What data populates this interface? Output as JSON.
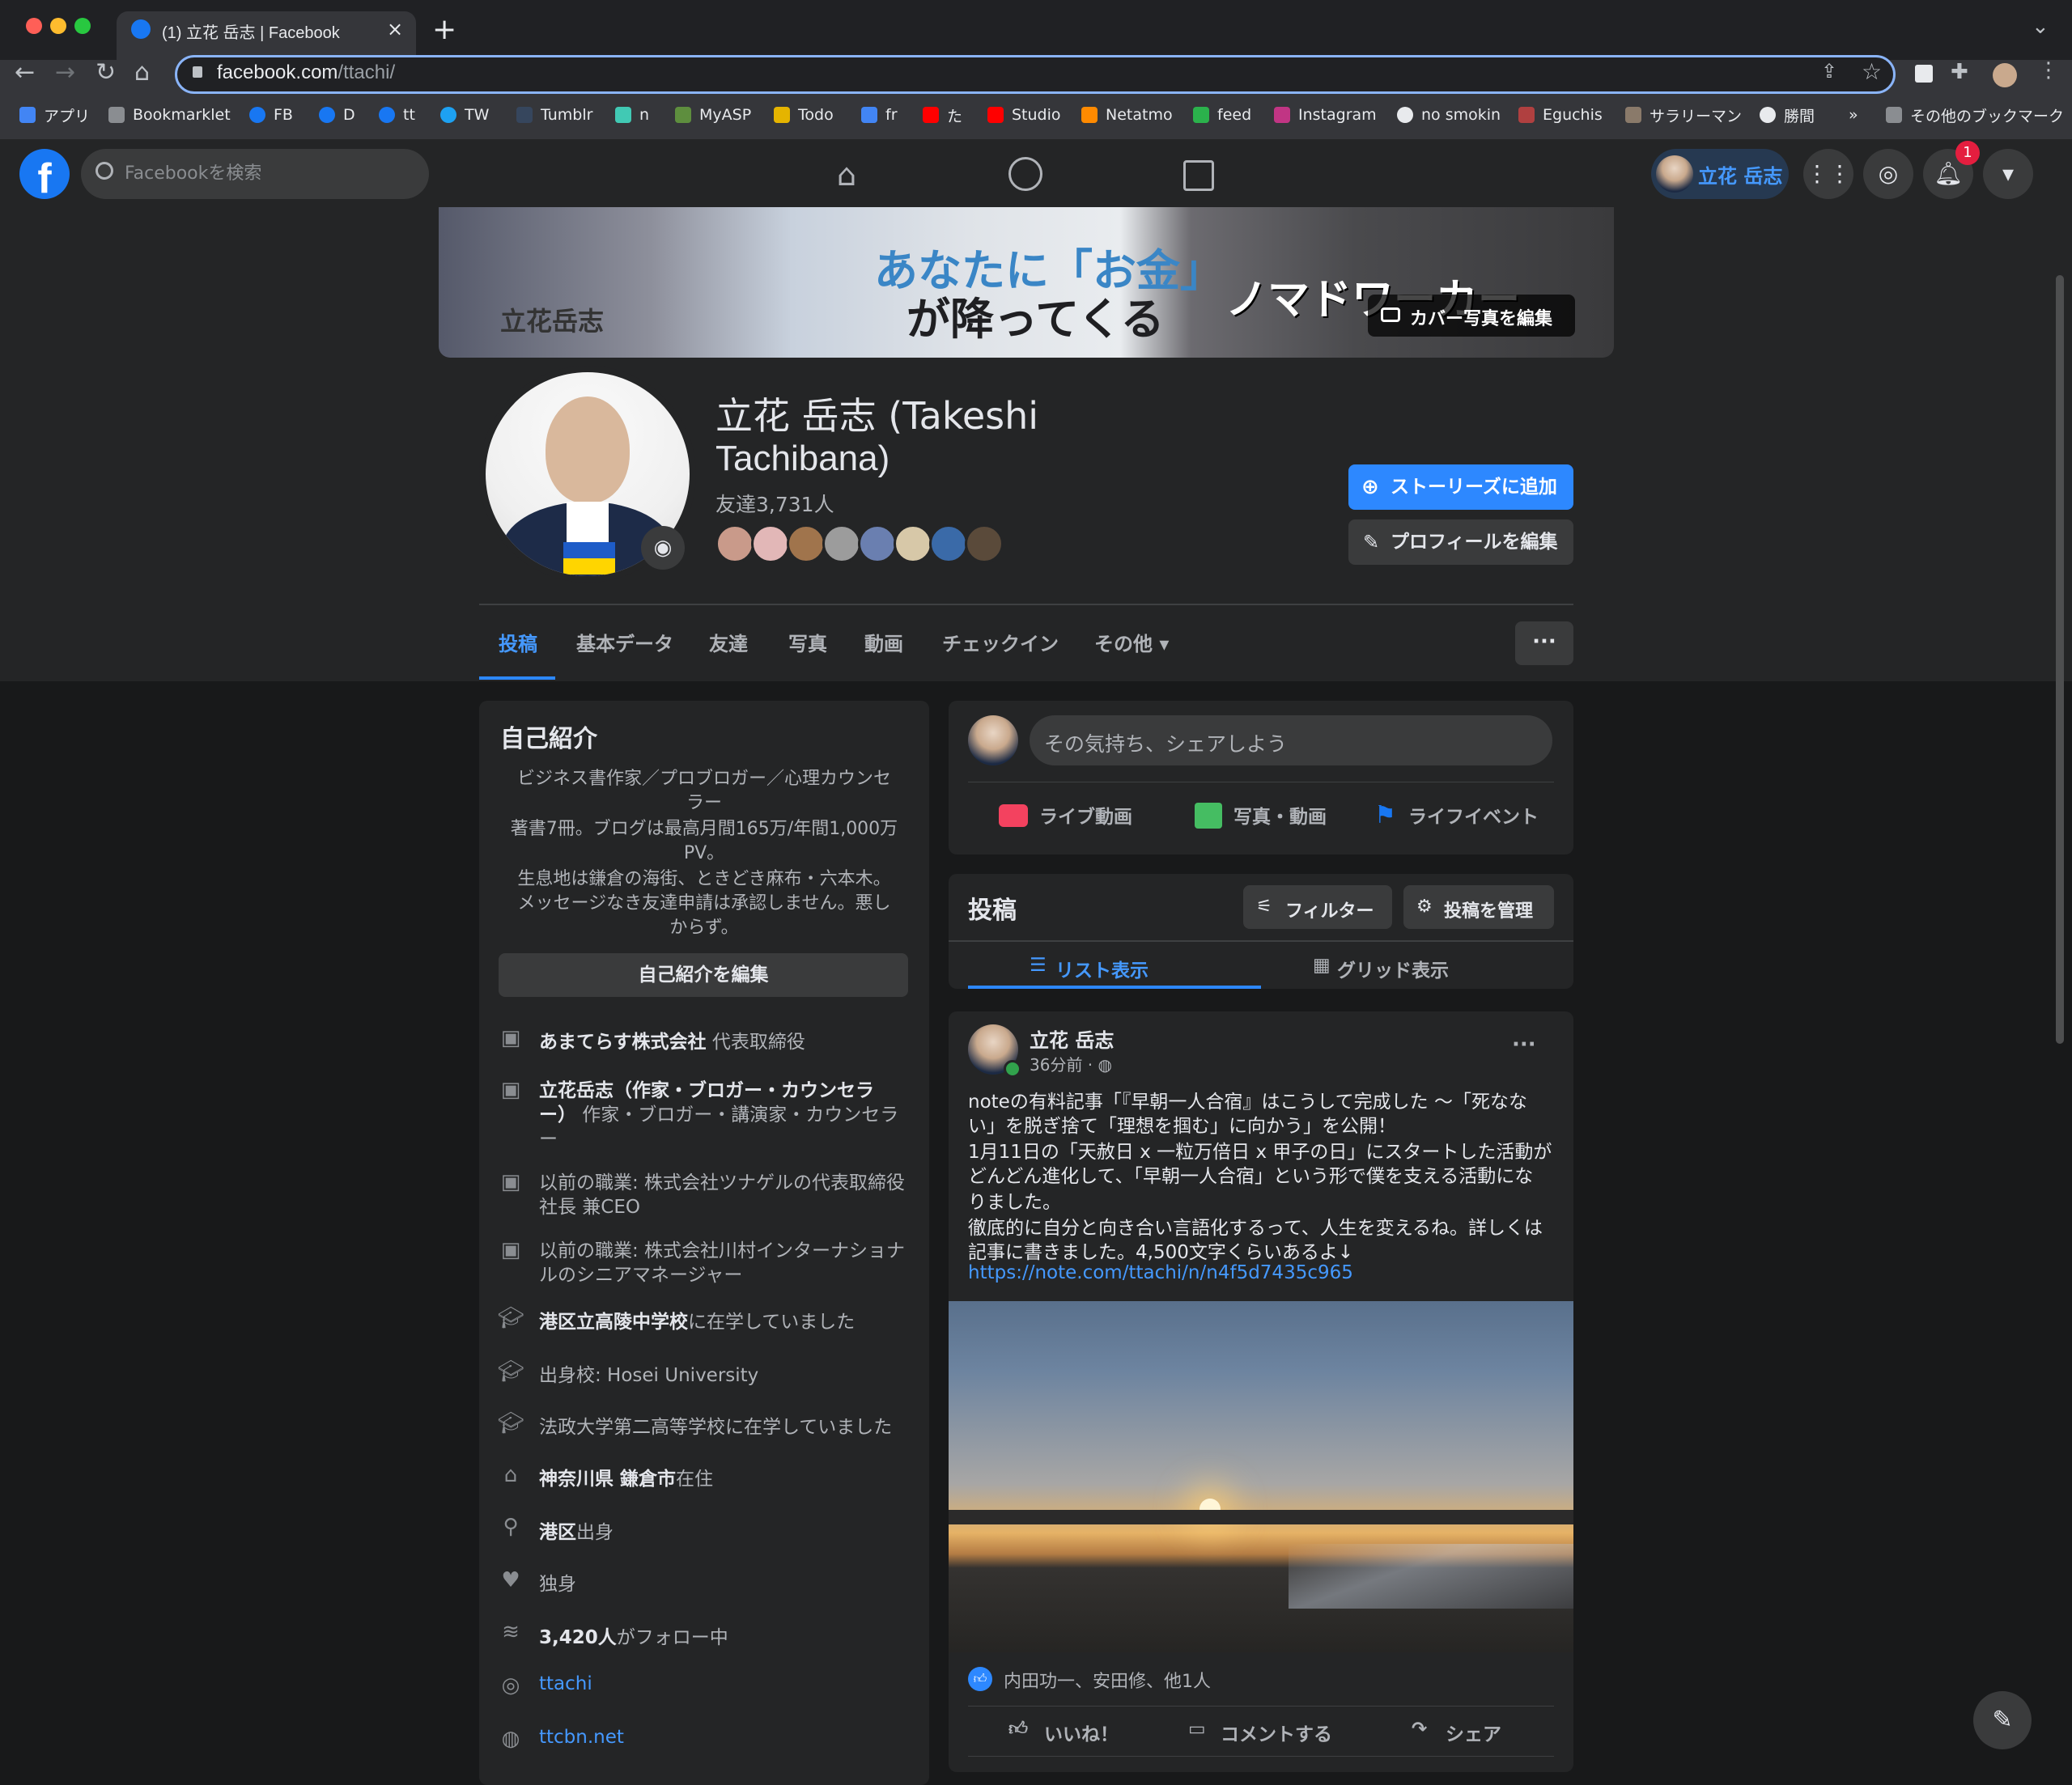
{
  "browser": {
    "tab_title": "(1) 立花 岳志 | Facebook",
    "url_host": "facebook.com",
    "url_path": "/ttachi/",
    "new_tab": "+",
    "tab_close": "×"
  },
  "bookmarks": [
    {
      "label": "アプリ",
      "color": "#4285f4"
    },
    {
      "label": "Bookmarklet",
      "color": "#8a8d91"
    },
    {
      "label": "FB",
      "color": "#1877f2"
    },
    {
      "label": "D",
      "color": "#1877f2"
    },
    {
      "label": "tt",
      "color": "#1877f2"
    },
    {
      "label": "TW",
      "color": "#1da1f2"
    },
    {
      "label": "Tumblr",
      "color": "#36465d"
    },
    {
      "label": "n",
      "color": "#41c9b4"
    },
    {
      "label": "MyASP",
      "color": "#5e8e3e"
    },
    {
      "label": "Todo",
      "color": "#e5b400"
    },
    {
      "label": "fr",
      "color": "#4285f4"
    },
    {
      "label": "た",
      "color": "#ff0000"
    },
    {
      "label": "Studio",
      "color": "#ff0000"
    },
    {
      "label": "Netatmo",
      "color": "#ff8a00"
    },
    {
      "label": "feed",
      "color": "#2bb24c"
    },
    {
      "label": "Instagram",
      "color": "#c13584"
    },
    {
      "label": "no smokin",
      "color": "#e8eaed"
    },
    {
      "label": "Eguchis",
      "color": "#b04040"
    },
    {
      "label": "サラリーマン",
      "color": "#8a7a6a"
    },
    {
      "label": "勝間",
      "color": "#e8eaed"
    },
    {
      "label": "»",
      "color": ""
    },
    {
      "label": "その他のブックマーク",
      "color": "#8a8d91"
    }
  ],
  "fb_header": {
    "search_placeholder": "Facebookを検索",
    "profile_name": "立花 岳志",
    "notification_count": "1"
  },
  "cover": {
    "text_blue": "あなたに「お金」",
    "text_dark": "が降ってくる",
    "text_author": "立花岳志",
    "text_nomad": "ノマドワーカー",
    "edit_label": "カバー写真を編集"
  },
  "profile": {
    "name_line1": "立花 岳志 (Takeshi",
    "name_line2": "Tachibana)",
    "friends_count": "友達3,731人",
    "add_story_label": "ストーリーズに追加",
    "edit_profile_label": "プロフィールを編集"
  },
  "profile_tabs": [
    "投稿",
    "基本データ",
    "友達",
    "写真",
    "動画",
    "チェックイン",
    "その他 ▾"
  ],
  "intro": {
    "title": "自己紹介",
    "bio_lines": [
      "ビジネス書作家／プロブロガー／心理カウンセ",
      "ラー",
      "著書7冊。ブログは最高月間165万/年間1,000万",
      "PV。",
      "生息地は鎌倉の海街、ときどき麻布・六本木。",
      "メッセージなき友達申請は承認しません。悪し",
      "からず。"
    ],
    "edit_bio_label": "自己紹介を編集",
    "items": [
      {
        "icon": "briefcase-icon",
        "bold": "あまてらす株式会社",
        "text": " 代表取締役"
      },
      {
        "icon": "briefcase-icon",
        "bold": "立花岳志（作家・ブロガー・カウンセラ",
        "text": ""
      },
      {
        "icon": "",
        "bold": "ー）",
        "text": " 作家・ブロガー・講演家・カウンセラ"
      },
      {
        "icon": "",
        "bold": "",
        "text": "ー"
      },
      {
        "icon": "briefcase-icon",
        "bold": "",
        "text": "以前の職業: 株式会社ツナゲルの代表取締役"
      },
      {
        "icon": "",
        "bold": "",
        "text": "社長 兼CEO"
      },
      {
        "icon": "briefcase-icon",
        "bold": "",
        "text": "以前の職業: 株式会社川村インターナショナ"
      },
      {
        "icon": "",
        "bold": "",
        "text": "ルのシニアマネージャー"
      },
      {
        "icon": "school-icon",
        "bold": "港区立高陵中学校",
        "text": "に在学していました"
      },
      {
        "icon": "school-icon",
        "bold": "",
        "text": "出身校: Hosei University"
      },
      {
        "icon": "school-icon",
        "bold": "",
        "text": "法政大学第二高等学校に在学していました"
      },
      {
        "icon": "home-icon",
        "bold": "神奈川県 鎌倉市",
        "text": "在住"
      },
      {
        "icon": "location-pin-icon",
        "bold": "港区",
        "text": "出身"
      },
      {
        "icon": "heart-icon",
        "bold": "",
        "text": "独身"
      },
      {
        "icon": "rss-icon",
        "bold": "3,420人",
        "text": "がフォロー中"
      }
    ],
    "instagram_link": "ttachi",
    "website_link": "ttcbn.net"
  },
  "composer": {
    "placeholder": "その気持ち、シェアしよう",
    "live_label": "ライブ動画",
    "photo_label": "写真・動画",
    "event_label": "ライフイベント"
  },
  "posts_header": {
    "title": "投稿",
    "filter_label": "フィルター",
    "manage_label": "投稿を管理",
    "list_view_label": "リスト表示",
    "grid_view_label": "グリッド表示"
  },
  "post": {
    "author": "立花 岳志",
    "time": "36分前 · ◍",
    "lines": [
      "noteの有料記事「『早朝一人合宿』はこうして完成した 〜「死なな",
      "い」を脱ぎ捨て「理想を掴む」に向かう」を公開！",
      "1月11日の「天赦日 x 一粒万倍日 x 甲子の日」にスタートした活動が",
      "どんどん進化して、「早朝一人合宿」という形で僕を支える活動にな",
      "りました。",
      "徹底的に自分と向き合い言語化するって、人生を変えるね。詳しくは",
      "記事に書きました。4,500文字くらいあるよ↓"
    ],
    "link": "https://note.com/ttachi/n/n4f5d7435c965",
    "reactions": "内田功一、安田修、他1人",
    "like_label": "いいね！",
    "comment_label": "コメントする",
    "share_label": "シェア"
  },
  "colors": {
    "accent": "#2d88ff",
    "bg": "#18191a",
    "card": "#242526"
  }
}
